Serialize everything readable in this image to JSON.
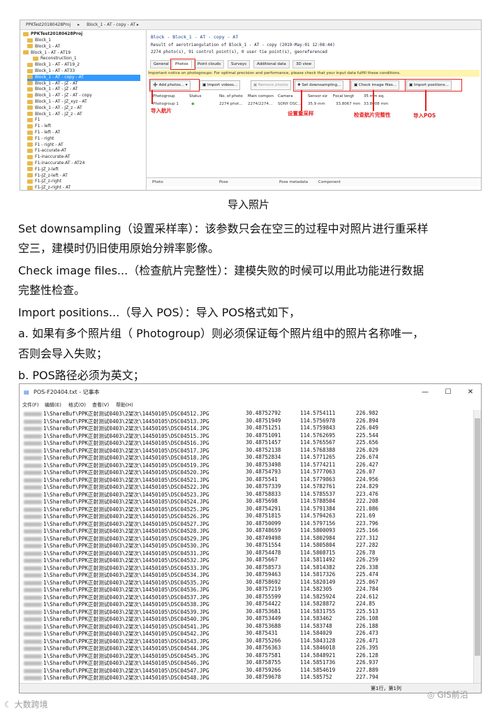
{
  "screenshot1": {
    "window_title": "PPKTest20180428Proj",
    "breadcrumb": "Block_1 - AT - copy - AT",
    "tree_root": "PPKTest20180428Proj",
    "tree_items": [
      "Block_1",
      "Block_1 - AT",
      "Block_1 - AT - AT19",
      "Reconstruction_1",
      "Block_1 - AT - AT19_2",
      "Block_1 - AT - AT33",
      "Block_1 - AT - copy - AT",
      "Block_1 - AT - JZ - AT",
      "Block_1 - AT - JZ - AT",
      "Block_1 - AT - JZ - AT - copy",
      "Block_1 - AT - JZ_xyz - AT",
      "Block_1 - AT - JZ_z - AT",
      "Block_1 - AT - JZ_z - AT",
      "F1",
      "F1 - left",
      "F1 - left - AT",
      "F1 - right",
      "F1 - right - AT",
      "F1-accurate-AT",
      "F1-inaccurate-AT",
      "F1-inaccurate-AT - AT24",
      "F1-JZ_z-left",
      "F1-JZ_z-left - AT",
      "F1-JZ_z-right",
      "F1-JZ_z-right - AT"
    ],
    "selected_index": 6,
    "header_title": "Block - Block_1 - AT - copy - AT",
    "header_line2": "Result of aerotriangulation of Block_1 - AT - copy (2019-May-01 12:08:44)",
    "header_line3": "2274 photo(s), 91 control point(s), 0 user tie point(s), georeferenced",
    "tabs": [
      "General",
      "Photos",
      "Point clouds",
      "Surveys",
      "Additional data",
      "3D view"
    ],
    "active_tab": "Photos",
    "notice": "Important notice on photogroups: For optimal precision and performance, please check that your input data fulfill these conditions.",
    "toolbar": {
      "add_photos": "Add photos...",
      "import_videos": "Import videos...",
      "remove_photos": "Remove photos",
      "set_downsampling": "Set downsampling...",
      "check_image_files": "Check image files...",
      "import_positions": "Import positions..."
    },
    "columns": [
      "Photogroup",
      "Status",
      "No. of photo",
      "Main compon",
      "Camera",
      "Sensor siz",
      "Focal lengt",
      "35 mm eq."
    ],
    "row": [
      "Photogroup 1",
      "",
      "2274 phot...",
      "2274/2274...",
      "SONY DSC...",
      "35.9 mm",
      "33.8067 mm",
      "33.8008 mm"
    ],
    "bottom_headers": [
      "Photo",
      "Pose",
      "Pose metadata",
      "Component"
    ],
    "annotations": {
      "import_photos": "导入航片",
      "set_sample_rate": "设置重采样",
      "check_integrity": "检查航片完整性",
      "import_pos": "导入POS"
    }
  },
  "caption": "导入照片",
  "paragraphs": [
    "Set downsampling（设置采样率）：该参数只会在空三的过程中对照片进行重采样",
    "空三，建模时仍旧使用原始分辨率影像。",
    "Check image files...（检查航片完整性）：建模失败的时候可以用此功能进行数据",
    "完整性检查。",
    "Import positions...（导入  POS）：导入  POS格式如下，",
    "a.  如果有多个照片组（  Photogroup）则必须保证每个照片组中的照片名称唯一，",
    "否则会导入失败；",
    "b.  POS路径必须为英文；"
  ],
  "notepad": {
    "title": "POS-F20404.txt - 记事本",
    "menu": [
      "文件(F)",
      "编辑(E)",
      "格式(O)",
      "查看(V)",
      "帮助(H)"
    ],
    "controls": [
      "—",
      "☐",
      "✕"
    ],
    "path_prefix": "1\\ShareBuf\\PPK正射测试0403\\2架次\\14450105\\",
    "rows": [
      [
        "DSC04512.JPG",
        "30.48752792",
        "114.5754111",
        "226.982"
      ],
      [
        "DSC04513.JPG",
        "30.48751949",
        "114.5756978",
        "226.894"
      ],
      [
        "DSC04514.JPG",
        "30.48751251",
        "114.5759843",
        "226.049"
      ],
      [
        "DSC04515.JPG",
        "30.48751091",
        "114.5762695",
        "225.544"
      ],
      [
        "DSC04516.JPG",
        "30.48751457",
        "114.5765567",
        "225.656"
      ],
      [
        "DSC04517.JPG",
        "30.48752138",
        "114.5768388",
        "226.029"
      ],
      [
        "DSC04518.JPG",
        "30.48752834",
        "114.5771265",
        "226.674"
      ],
      [
        "DSC04519.JPG",
        "30.48753498",
        "114.5774211",
        "226.427"
      ],
      [
        "DSC04520.JPG",
        "30.48754793",
        "114.5777063",
        "226.07"
      ],
      [
        "DSC04521.JPG",
        "30.4875541",
        "114.5779863",
        "224.956"
      ],
      [
        "DSC04522.JPG",
        "30.48757339",
        "114.5782761",
        "224.829"
      ],
      [
        "DSC04523.JPG",
        "30.48758833",
        "114.5785537",
        "223.476"
      ],
      [
        "DSC04524.JPG",
        "30.4875698",
        "114.5788504",
        "222.208"
      ],
      [
        "DSC04525.JPG",
        "30.48754291",
        "114.5791384",
        "221.086"
      ],
      [
        "DSC04526.JPG",
        "30.48751815",
        "114.5794263",
        "221.69"
      ],
      [
        "DSC04527.JPG",
        "30.48750099",
        "114.5797156",
        "223.796"
      ],
      [
        "DSC04528.JPG",
        "30.48748659",
        "114.5800093",
        "225.166"
      ],
      [
        "DSC04529.JPG",
        "30.48749498",
        "114.5802984",
        "227.312"
      ],
      [
        "DSC04530.JPG",
        "30.48751554",
        "114.5805804",
        "227.282"
      ],
      [
        "DSC04531.JPG",
        "30.48754478",
        "114.5808715",
        "226.78"
      ],
      [
        "DSC04532.JPG",
        "30.4875667",
        "114.5811492",
        "226.259"
      ],
      [
        "DSC04533.JPG",
        "30.48758573",
        "114.5814382",
        "226.338"
      ],
      [
        "DSC04534.JPG",
        "30.48759463",
        "114.5817326",
        "225.474"
      ],
      [
        "DSC04535.JPG",
        "30.48758692",
        "114.5820149",
        "225.067"
      ],
      [
        "DSC04536.JPG",
        "30.48757219",
        "114.582305",
        "224.784"
      ],
      [
        "DSC04537.JPG",
        "30.48755599",
        "114.5825924",
        "224.612"
      ],
      [
        "DSC04538.JPG",
        "30.48754422",
        "114.5828872",
        "224.85"
      ],
      [
        "DSC04539.JPG",
        "30.48753681",
        "114.5831755",
        "225.513"
      ],
      [
        "DSC04540.JPG",
        "30.48753449",
        "114.583462",
        "226.108"
      ],
      [
        "DSC04541.JPG",
        "30.48753688",
        "114.583748",
        "226.188"
      ],
      [
        "DSC04542.JPG",
        "30.4875431",
        "114.584029",
        "226.473"
      ],
      [
        "DSC04543.JPG",
        "30.48755266",
        "114.5843128",
        "226.471"
      ],
      [
        "DSC04544.JPG",
        "30.48756363",
        "114.5846018",
        "226.395"
      ],
      [
        "DSC04545.JPG",
        "30.48757581",
        "114.5848921",
        "226.128"
      ],
      [
        "DSC04546.JPG",
        "30.48758755",
        "114.5851736",
        "226.937"
      ],
      [
        "DSC04547.JPG",
        "30.48759266",
        "114.5854619",
        "227.889"
      ],
      [
        "DSC04548.JPG",
        "30.48759678",
        "114.585752",
        "227.794"
      ]
    ],
    "status": "第1行，第1列"
  },
  "watermarks": {
    "left": "大数跨境",
    "right": "GIS前沿"
  }
}
